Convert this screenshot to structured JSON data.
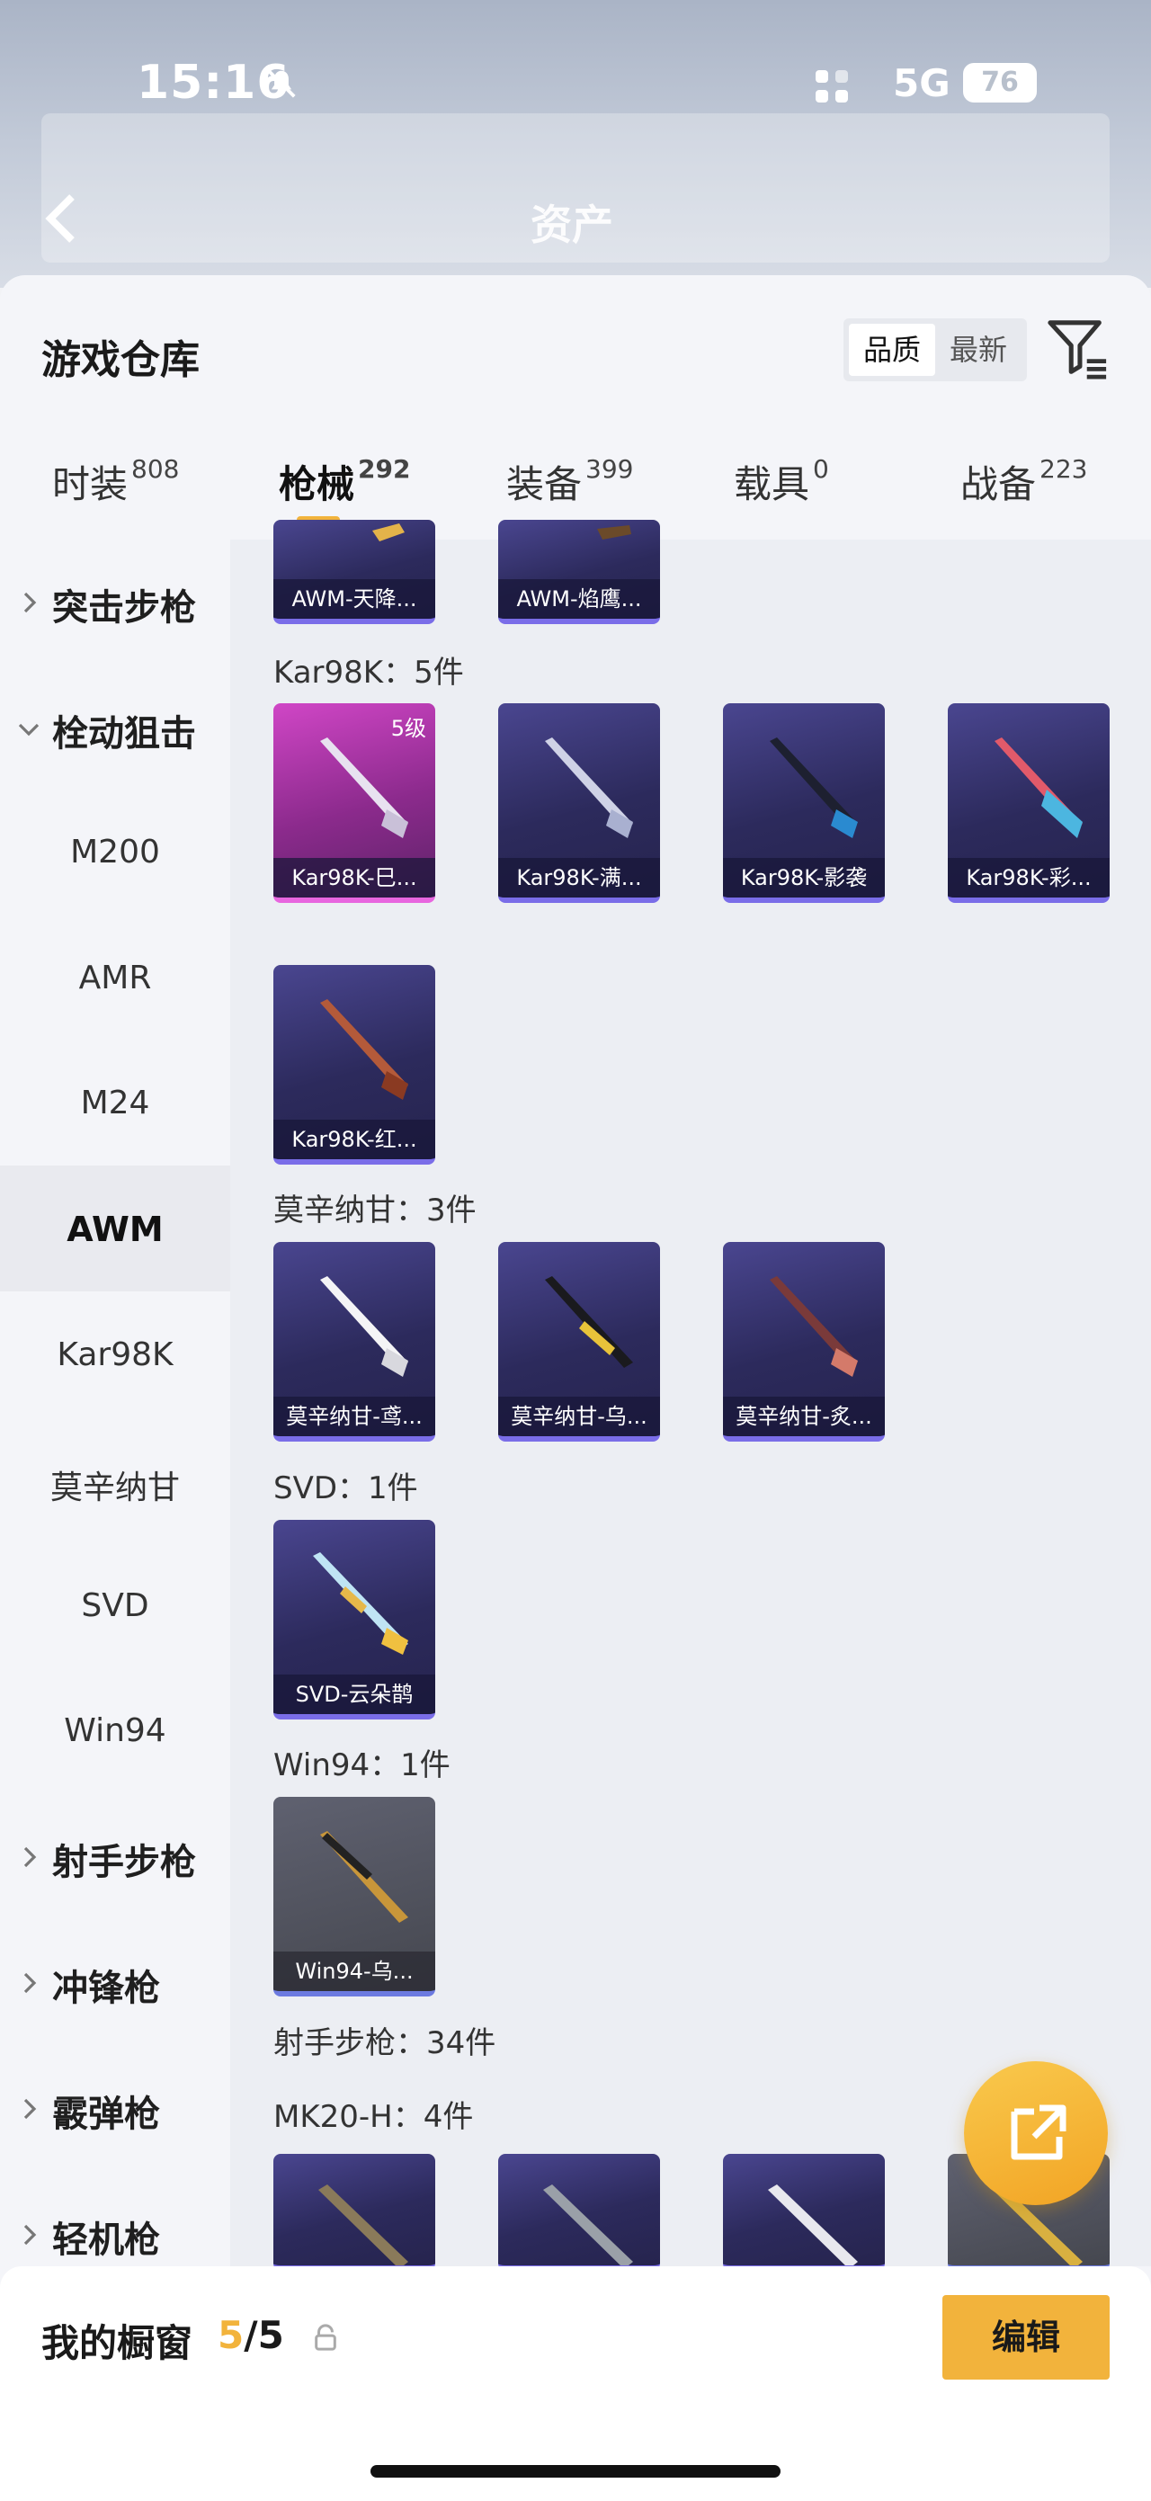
{
  "status_bar": {
    "time": "15:16",
    "network": "5G",
    "battery": "76"
  },
  "background_header": {
    "title": "资产"
  },
  "sheet": {
    "title": "游戏仓库",
    "sort": {
      "quality": "品质",
      "newest": "最新"
    }
  },
  "tabs": [
    {
      "label": "时装",
      "count": "808"
    },
    {
      "label": "枪械",
      "count": "292"
    },
    {
      "label": "装备",
      "count": "399"
    },
    {
      "label": "载具",
      "count": "0"
    },
    {
      "label": "战备",
      "count": "223"
    }
  ],
  "sidebar": {
    "categories": [
      "突击步枪",
      "栓动狙击",
      "射手步枪",
      "冲锋枪",
      "霰弹枪",
      "轻机枪"
    ],
    "sniper_items": [
      "M200",
      "AMR",
      "M24",
      "AWM",
      "Kar98K",
      "莫辛纳甘",
      "SVD",
      "Win94"
    ],
    "selected": "AWM"
  },
  "content": {
    "top_partial": [
      "AWM-天降...",
      "AWM-焰鹰..."
    ],
    "groups": [
      {
        "title": "Kar98K：5件",
        "items": [
          {
            "label": "Kar98K-巳...",
            "badge": "5级"
          },
          {
            "label": "Kar98K-满..."
          },
          {
            "label": "Kar98K-影袭"
          },
          {
            "label": "Kar98K-彩..."
          },
          {
            "label": "Kar98K-红..."
          }
        ]
      },
      {
        "title": "莫辛纳甘：3件",
        "items": [
          {
            "label": "莫辛纳甘-鸢..."
          },
          {
            "label": "莫辛纳甘-乌..."
          },
          {
            "label": "莫辛纳甘-炙..."
          }
        ]
      },
      {
        "title": "SVD：1件",
        "items": [
          {
            "label": "SVD-云朵鹊"
          }
        ]
      },
      {
        "title": "Win94：1件",
        "items": [
          {
            "label": "Win94-乌..."
          }
        ]
      }
    ],
    "section_marksman": "射手步枪：34件",
    "group_mk20": "MK20-H：4件"
  },
  "showcase": {
    "label": "我的橱窗",
    "current": "5",
    "total": "/5",
    "edit": "编辑"
  },
  "colors": {
    "accent": "#f2b33c",
    "card_purple": "#2c2a5c",
    "card_pink": "#d046c6"
  }
}
